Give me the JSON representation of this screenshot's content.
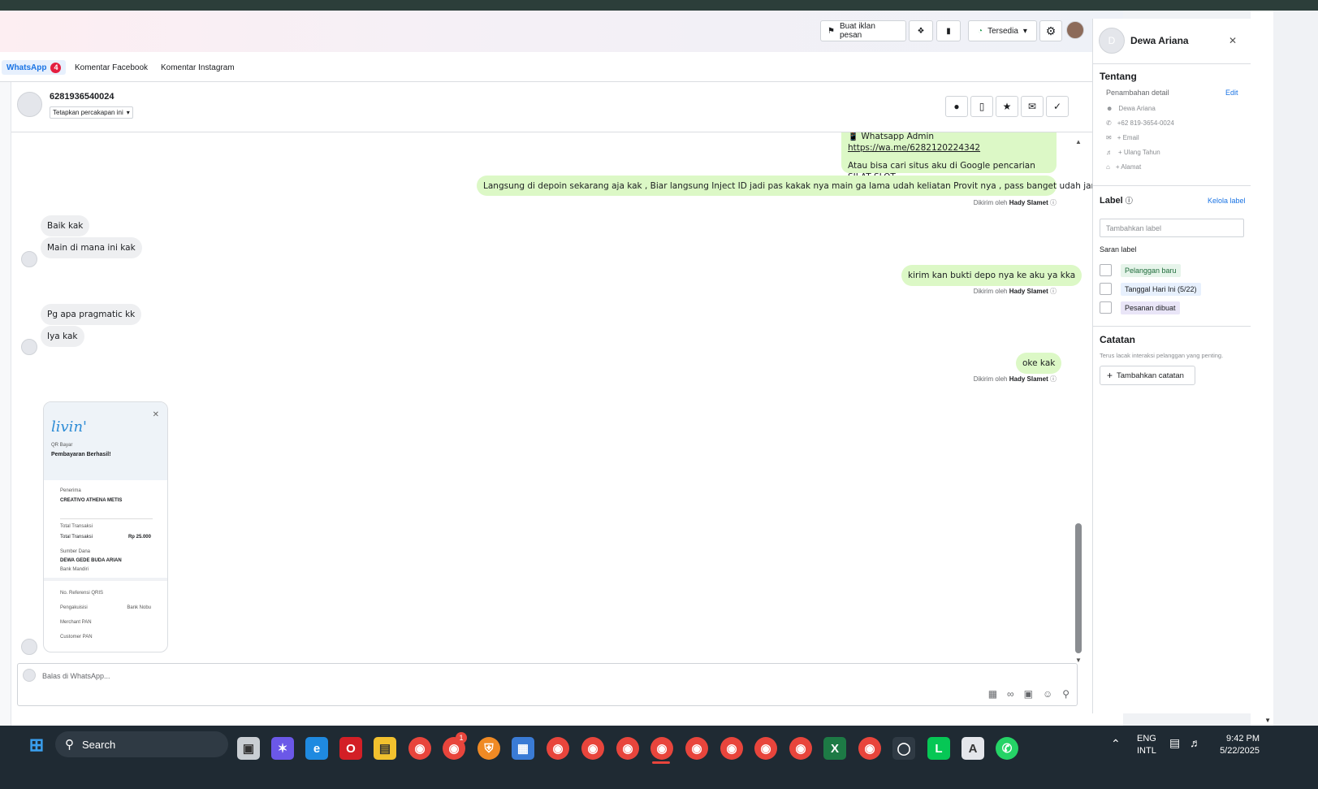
{
  "header": {
    "ad_button": "Buat iklan pesan",
    "status_label": "Tersedia"
  },
  "tabs": [
    {
      "label": "WhatsApp",
      "badge": "4"
    },
    {
      "label": "Komentar Facebook"
    },
    {
      "label": "Komentar Instagram"
    }
  ],
  "conversation": {
    "phone": "6281936540024",
    "assign_label": "Tetapkan percakapan ini"
  },
  "messages": {
    "out1_line1": "Whatsapp Admin",
    "out1_link": "https://wa.me/6282120224342",
    "out1_line3": "Atau bisa cari situs aku di Google pencarian SILAT SLOT",
    "out2": "Langsung di depoin sekarang aja kak , Biar langsung Inject ID jadi pas kakak nya main ga lama udah keliatan Provit nya , pass banget udah jam Gacor juga",
    "in1": "Baik kak",
    "in2": "Main di mana ini kak",
    "out3": "kirim kan bukti depo nya ke aku ya kka",
    "in3": "Pg apa pragmatic kk",
    "in4": "Iya kak",
    "out4": "oke kak",
    "sent_prefix": "Dikirim oleh",
    "sent_by": "Hady Slamet"
  },
  "receipt": {
    "logo": "livin'",
    "subtitle": "QR Bayar",
    "title": "Pembayaran Berhasil!",
    "recipient_label": "Penerima",
    "recipient": "CREATIVO ATHENA METIS",
    "total_label": "Total Transaksi",
    "total_label2": "Total Transaksi",
    "amount": "Rp 25.000",
    "source_label": "Sumber Dana",
    "source": "DEWA GEDE BUDA ARIAN",
    "bank": "Bank Mandiri",
    "row1_label": "No. Referensi QRIS",
    "row2_label": "Pengakuisisi",
    "row2_value": "Bank Nobu",
    "row3_label": "Merchant PAN",
    "row4_label": "Customer PAN"
  },
  "compose": {
    "placeholder": "Balas di WhatsApp..."
  },
  "contact": {
    "initial": "D",
    "name": "Dewa Ariana",
    "about_title": "Tentang",
    "details_label": "Penambahan detail",
    "edit_label": "Edit",
    "name_row": "Dewa Ariana",
    "phone_row": "+62 819-3654-0024",
    "email_row": "+ Email",
    "birthday_row": "+ Ulang Tahun",
    "address_row": "+ Alamat",
    "label_title": "Label",
    "manage_label": "Kelola label",
    "label_placeholder": "Tambahkan label",
    "suggest_title": "Saran label",
    "suggestions": [
      "Pelanggan baru",
      "Tanggal Hari Ini (5/22)",
      "Pesanan dibuat"
    ],
    "notes_title": "Catatan",
    "notes_desc": "Terus lacak interaksi pelanggan yang penting.",
    "add_note": "Tambahkan catatan"
  },
  "taskbar": {
    "search": "Search",
    "lang1": "ENG",
    "lang2": "INTL",
    "time": "9:42 PM",
    "date": "5/22/2025",
    "notif_count": "1"
  },
  "colors": {
    "accent": "#1b74e4",
    "outgoing_bubble": "#dcf8c6",
    "incoming_bubble": "#eeeff1",
    "badge": "#e41e3f"
  }
}
